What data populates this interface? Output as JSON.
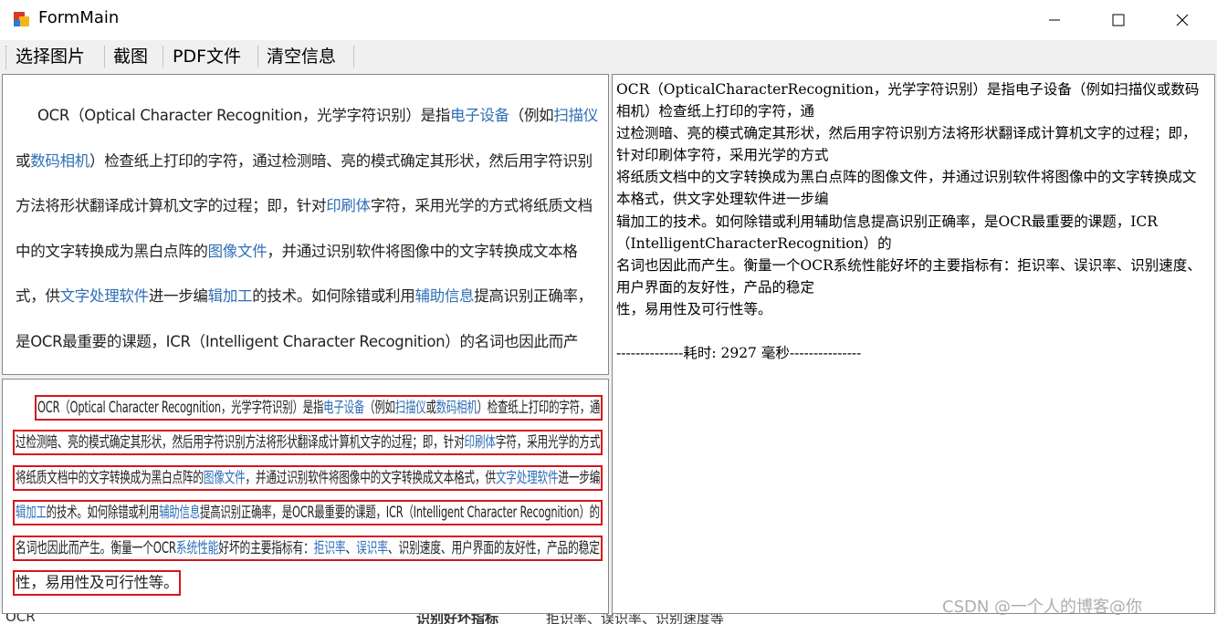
{
  "window": {
    "title": "FormMain",
    "colors": {
      "accent_red": "#d8141c",
      "link_blue": "#2f6fb6"
    }
  },
  "menu": {
    "items": [
      "选择图片",
      "截图",
      "PDF文件",
      "清空信息"
    ]
  },
  "image_panel": {
    "segments": [
      {
        "t": "OCR（Optical Character Recognition，光学字符识别）是指"
      },
      {
        "t": "电子设备",
        "link": true
      },
      {
        "t": "（例如"
      },
      {
        "t": "扫描仪",
        "link": true
      },
      {
        "t": "或"
      },
      {
        "t": "数码相机",
        "link": true
      },
      {
        "t": "）检查纸上打印的字符，通过检测暗、亮的模式确定其形状，然后用字符识别方法将形状翻译成计算机文字的过程；即，针对"
      },
      {
        "t": "印刷体",
        "link": true
      },
      {
        "t": "字符，采用光学的方式将纸质文档中的文字转换成为黑白点阵的"
      },
      {
        "t": "图像文件",
        "link": true
      },
      {
        "t": "，并通过识别软件将图像中的文字转换成文本格式，供"
      },
      {
        "t": "文字处理软件",
        "link": true
      },
      {
        "t": "进一步编"
      },
      {
        "t": "辑加工",
        "link": true
      },
      {
        "t": "的技术。如何除错或利用"
      },
      {
        "t": "辅助信息",
        "link": true
      },
      {
        "t": "提高识别正确率，是OCR最重要的课题，ICR（Intelligent Character Recognition）的名词也因此而产生。衡量一个OCR"
      },
      {
        "t": "系统性能",
        "link": true
      },
      {
        "t": "好坏的主要指标有："
      },
      {
        "t": "拒识率",
        "link": true
      },
      {
        "t": "、"
      },
      {
        "t": "误识率",
        "link": true
      },
      {
        "t": "、识别速度、用户界面的友好性，产品的稳定性，易用性及可行性等。"
      }
    ]
  },
  "detected_panel": {
    "lines": [
      [
        {
          "t": "OCR（Optical Character Recognition，光学字符识别）是指"
        },
        {
          "t": "电子设备",
          "link": true
        },
        {
          "t": "（例如"
        },
        {
          "t": "扫描仪",
          "link": true
        },
        {
          "t": "或"
        },
        {
          "t": "数码相机",
          "link": true
        },
        {
          "t": "）检查纸上打印的字符，通"
        }
      ],
      [
        {
          "t": "过检测暗、亮的模式确定其形状，然后用字符识别方法将形状翻译成计算机文字的过程；即，针对"
        },
        {
          "t": "印刷体",
          "link": true
        },
        {
          "t": "字符，采用光学的方式"
        }
      ],
      [
        {
          "t": "将纸质文档中的文字转换成为黑白点阵的"
        },
        {
          "t": "图像文件",
          "link": true
        },
        {
          "t": "，并通过识别软件将图像中的文字转换成文本格式，供"
        },
        {
          "t": "文字处理软件",
          "link": true
        },
        {
          "t": "进一步编"
        }
      ],
      [
        {
          "t": "辑加工",
          "link": true
        },
        {
          "t": "的技术。如何除错或利用"
        },
        {
          "t": "辅助信息",
          "link": true
        },
        {
          "t": "提高识别正确率，是OCR最重要的课题，ICR（Intelligent Character Recognition）的"
        }
      ],
      [
        {
          "t": "名词也因此而产生。衡量一个OCR"
        },
        {
          "t": "系统性能",
          "link": true
        },
        {
          "t": "好坏的主要指标有："
        },
        {
          "t": "拒识率",
          "link": true
        },
        {
          "t": "、"
        },
        {
          "t": "误识率",
          "link": true
        },
        {
          "t": "、识别速度、用户界面的友好性，产品的稳定"
        }
      ],
      [
        {
          "t": "性，易用性及可行性等。"
        }
      ]
    ]
  },
  "result_panel": {
    "text": "OCR（OpticalCharacterRecognition，光学字符识别）是指电子设备（例如扫描仪或数码相机）检查纸上打印的字符，通\n过检测暗、亮的模式确定其形状，然后用字符识别方法将形状翻译成计算机文字的过程；即，针对印刷体字符，采用光学的方式\n将纸质文档中的文字转换成为黑白点阵的图像文件，并通过识别软件将图像中的文字转换成文本格式，供文字处理软件进一步编\n辑加工的技术。如何除错或利用辅助信息提高识别正确率，是OCR最重要的课题，ICR（IntelligentCharacterRecognition）的\n名词也因此而产生。衡量一个OCR系统性能好坏的主要指标有：拒识率、误识率、识别速度、用户界面的友好性，产品的稳定\n性，易用性及可行性等。\n\n--------------耗时: 2927 毫秒---------------"
  },
  "background": {
    "left_text": "OCR",
    "mid_text": "识别好坏指标",
    "right_text": "拒识率、误识率、识别速度等"
  },
  "watermark": "CSDN @一个人的博客@你"
}
